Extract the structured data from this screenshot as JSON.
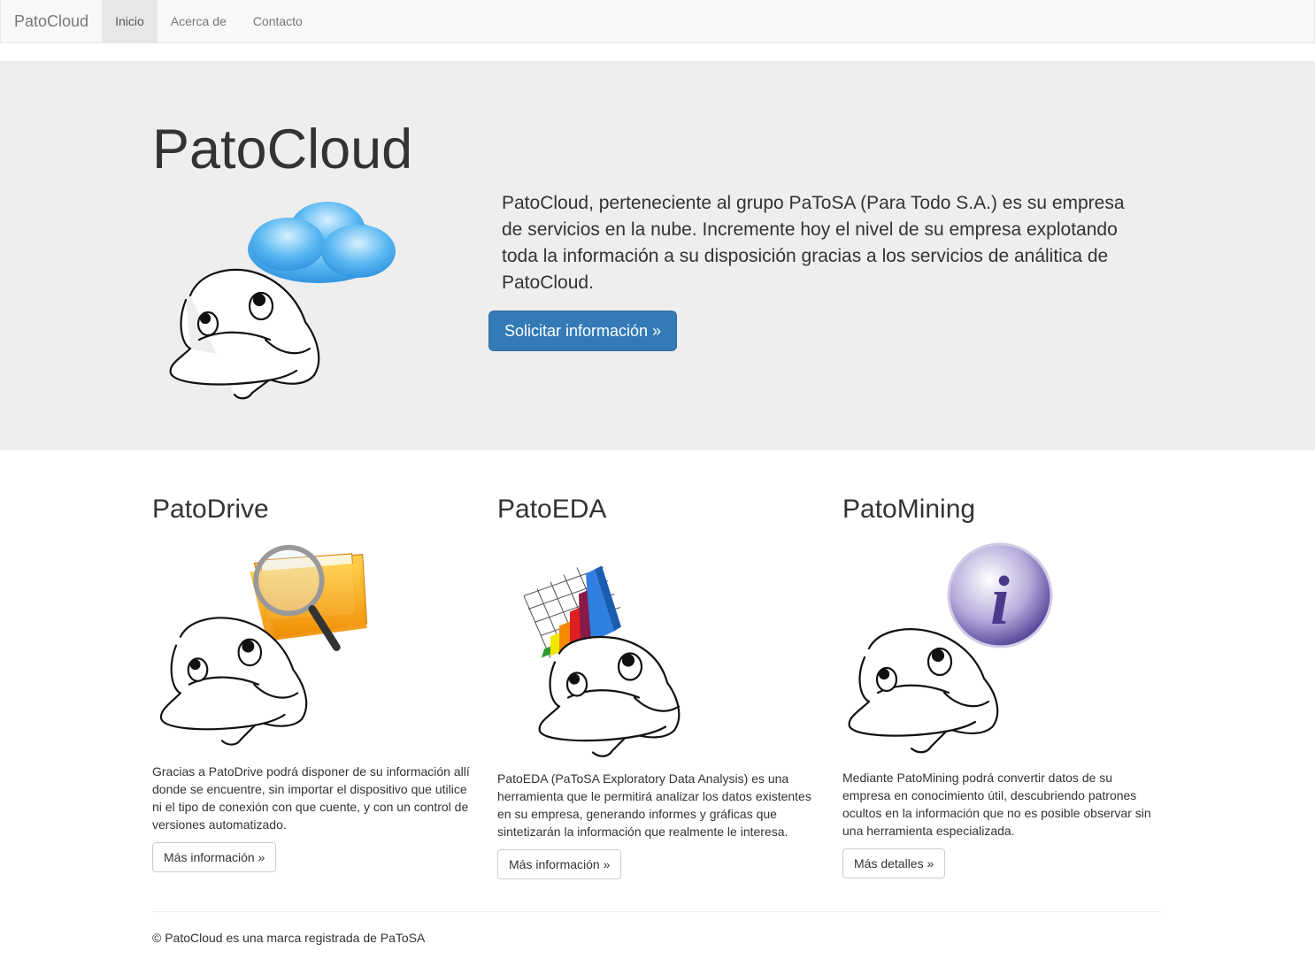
{
  "navbar": {
    "brand": "PatoCloud",
    "items": [
      {
        "label": "Inicio",
        "active": true
      },
      {
        "label": "Acerca de",
        "active": false
      },
      {
        "label": "Contacto",
        "active": false
      }
    ]
  },
  "jumbotron": {
    "title": "PatoCloud",
    "text": "PatoCloud, perteneciente al grupo PaToSA (Para Todo S.A.) es su empresa de servicios en la nube. Incremente hoy el nivel de su empresa explotando toda la información a su disposición gracias a los servicios de análitica de PatoCloud.",
    "button": "Solicitar información »"
  },
  "features": [
    {
      "title": "PatoDrive",
      "icon": "folder-magnifier-duck",
      "text": "Gracias a PatoDrive podrá disponer de su información allí donde se encuentre, sin importar el dispositivo que utilice ni el tipo de conexión con que cuente, y con un control de versiones automatizado.",
      "button": "Más información »"
    },
    {
      "title": "PatoEDA",
      "icon": "bar-chart-duck",
      "text": "PatoEDA (PaToSA Exploratory Data Analysis) es una herramienta que le permitirá analizar los datos existentes en su empresa, generando informes y gráficas que sintetizarán la información que realmente le interesa.",
      "button": "Más información »"
    },
    {
      "title": "PatoMining",
      "icon": "info-duck",
      "text": "Mediante PatoMining podrá convertir datos de su empresa en conocimiento útil, descubriendo patrones ocultos en la información que no es posible observar sin una herramienta especializada.",
      "button": "Más detalles »"
    }
  ],
  "footer": {
    "text": "© PatoCloud es una marca registrada de PaToSA"
  },
  "colors": {
    "primary": "#337ab7",
    "jumbotron_bg": "#eeeeee",
    "navbar_bg": "#f8f8f8"
  }
}
